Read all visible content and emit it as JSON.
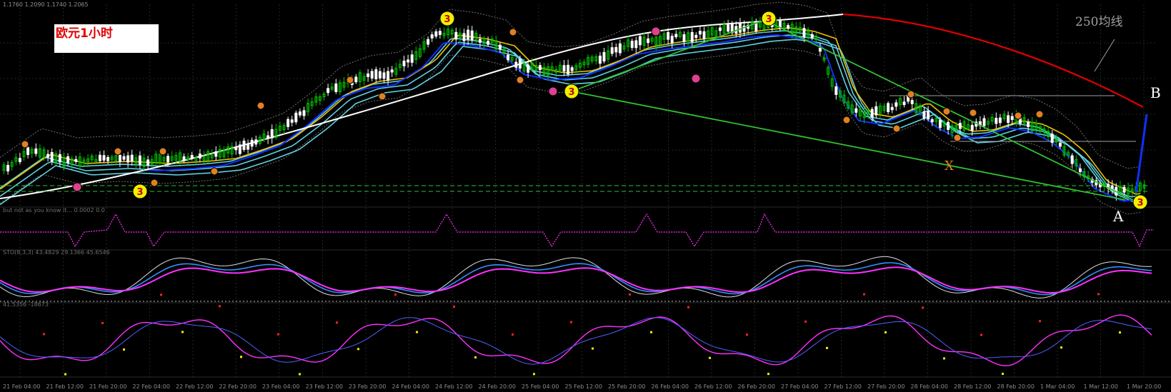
{
  "header": {
    "symbol_info": "1.1760  1.2090  1.1740  1.2065",
    "chart_title": "欧元1小时",
    "ma_note": "250均线"
  },
  "annotations": {
    "point_a": "A",
    "point_b": "B",
    "point_x": "X",
    "wave_label": "3"
  },
  "subpanels": {
    "panel1_info": "but not as you know it... 0.0002 0.0",
    "panel2_info": "STO(8,3,3) 43.4829  29.1366  45.6546",
    "panel3_info": "41.5356  -18673"
  },
  "x_axis": {
    "ticks": [
      "21 Feb 04:00",
      "21 Feb 12:00",
      "21 Feb 20:00",
      "22 Feb 04:00",
      "22 Feb 12:00",
      "22 Feb 20:00",
      "23 Feb 04:00",
      "23 Feb 12:00",
      "23 Feb 20:00",
      "24 Feb 04:00",
      "24 Feb 12:00",
      "24 Feb 20:00",
      "25 Feb 04:00",
      "25 Feb 12:00",
      "25 Feb 20:00",
      "26 Feb 04:00",
      "26 Feb 12:00",
      "26 Feb 20:00",
      "27 Feb 04:00",
      "27 Feb 12:00",
      "27 Feb 20:00",
      "28 Feb 04:00",
      "28 Feb 12:00",
      "28 Feb 20:00",
      "1 Mar 04:00",
      "1 Mar 12:00",
      "1 Mar 20:00"
    ]
  },
  "colors": {
    "background": "#000000",
    "bull_candle": "#00c000",
    "bear_candle": "#ffffff",
    "ma250": "#e00000",
    "ma_fast_white": "#ffffff",
    "ma_blue": "#1030ff",
    "ma_yellow": "#f0c000",
    "band_cyan": "#60d0e0",
    "trend_green": "#30c030",
    "stoch_magenta": "#ff30ff",
    "stoch_blue": "#3090ff"
  },
  "chart_data": {
    "type": "line",
    "title": "欧元1小时",
    "xlabel": "",
    "ylabel": "",
    "categories": [
      "21 Feb 04:00",
      "21 Feb 12:00",
      "21 Feb 20:00",
      "22 Feb 04:00",
      "22 Feb 12:00",
      "22 Feb 20:00",
      "23 Feb 04:00",
      "23 Feb 12:00",
      "23 Feb 20:00",
      "24 Feb 04:00",
      "24 Feb 12:00",
      "24 Feb 20:00",
      "25 Feb 04:00",
      "25 Feb 12:00",
      "25 Feb 20:00",
      "26 Feb 04:00",
      "26 Feb 12:00",
      "26 Feb 20:00",
      "27 Feb 04:00",
      "27 Feb 12:00",
      "27 Feb 20:00",
      "28 Feb 04:00",
      "28 Feb 12:00",
      "28 Feb 20:00",
      "1 Mar 04:00",
      "1 Mar 12:00",
      "1 Mar 20:00"
    ],
    "series": [
      {
        "name": "250均线",
        "values": [
          1.212,
          1.2125,
          1.2129,
          1.2132,
          1.2135,
          1.2137,
          1.2138,
          1.2139,
          1.214,
          1.2141,
          1.2142,
          1.2143,
          1.2143,
          1.2144,
          1.2144,
          1.2145,
          1.2146,
          1.2146,
          1.2146,
          1.2144,
          1.2141,
          1.2137,
          1.2132,
          1.2126,
          1.2118,
          1.211,
          1.21
        ]
      },
      {
        "name": "price",
        "values": [
          1.184,
          1.1845,
          1.1838,
          1.1842,
          1.185,
          1.186,
          1.19,
          1.195,
          1.199,
          1.204,
          1.208,
          1.206,
          1.202,
          1.203,
          1.204,
          1.205,
          1.206,
          1.208,
          1.21,
          1.202,
          1.199,
          1.196,
          1.197,
          1.195,
          1.19,
          1.186,
          1.182
        ]
      }
    ]
  }
}
